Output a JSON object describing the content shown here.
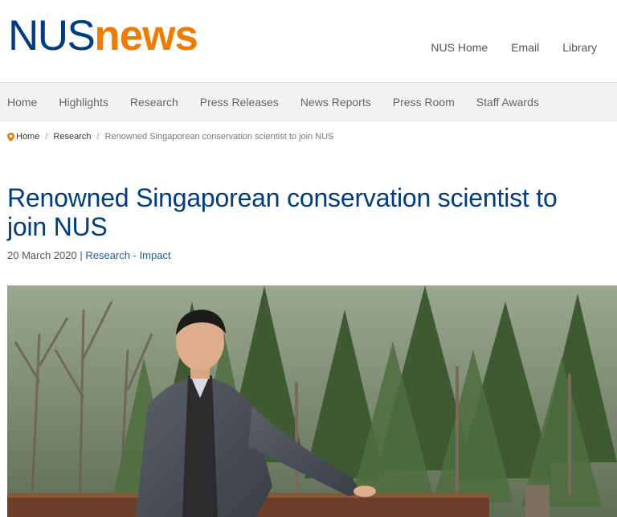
{
  "header": {
    "logo": {
      "part1": "NUS",
      "part2": "news"
    },
    "utility_links": [
      "NUS Home",
      "Email",
      "Library"
    ]
  },
  "nav": {
    "items": [
      "Home",
      "Highlights",
      "Research",
      "Press Releases",
      "News Reports",
      "Press Room",
      "Staff Awards"
    ]
  },
  "breadcrumb": {
    "home": "Home",
    "section": "Research",
    "current": "Renowned Singaporean conservation scientist to join NUS"
  },
  "article": {
    "title": "Renowned Singaporean conservation scientist to join NUS",
    "date": "20 March 2020",
    "separator": "|",
    "category": "Research - Impact"
  },
  "colors": {
    "brand_blue": "#003d7c",
    "brand_orange": "#ef7c00",
    "link_blue": "#1f5d99"
  },
  "icons": {
    "breadcrumb_home": "map-pin-icon"
  }
}
